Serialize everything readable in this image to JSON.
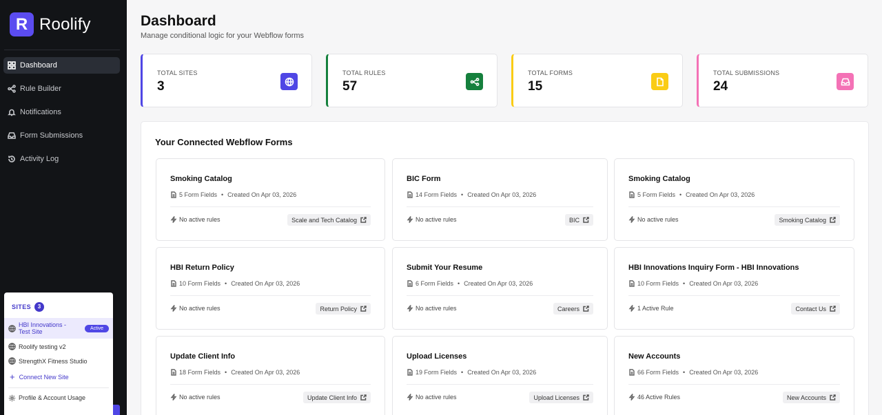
{
  "brand": {
    "logo_letter": "R",
    "name": "Roolify"
  },
  "nav": [
    {
      "label": "Dashboard",
      "icon": "grid-icon",
      "active": true
    },
    {
      "label": "Rule Builder",
      "icon": "share-icon",
      "active": false
    },
    {
      "label": "Notifications",
      "icon": "bell-icon",
      "active": false
    },
    {
      "label": "Form Submissions",
      "icon": "inbox-icon",
      "active": false
    },
    {
      "label": "Activity Log",
      "icon": "history-icon",
      "active": false
    }
  ],
  "sites_popover": {
    "label": "SITES",
    "count": "3",
    "sites": [
      {
        "name": "HBI Innovations - Test Site",
        "badge": "Active"
      },
      {
        "name": "Roolify testing v2"
      },
      {
        "name": "StrengthX Fitness Studio"
      }
    ],
    "connect_label": "Connect New Site",
    "profile_label": "Profile & Account Usage"
  },
  "header": {
    "title": "Dashboard",
    "subtitle": "Manage conditional logic for your Webflow forms"
  },
  "stats": [
    {
      "label": "TOTAL SITES",
      "value": "3",
      "color": "#4f46e5",
      "icon": "globe-icon"
    },
    {
      "label": "TOTAL RULES",
      "value": "57",
      "color": "#15803d",
      "icon": "share-icon"
    },
    {
      "label": "TOTAL FORMS",
      "value": "15",
      "color": "#facc15",
      "icon": "file-icon"
    },
    {
      "label": "TOTAL SUBMISSIONS",
      "value": "24",
      "color": "#f472b6",
      "icon": "inbox-icon"
    }
  ],
  "forms_panel": {
    "title": "Your Connected Webflow Forms",
    "forms": [
      {
        "title": "Smoking Catalog",
        "fields": "5 Form Fields",
        "created": "Created On Apr 03, 2026",
        "rules": "No active rules",
        "tag": "Scale and Tech Catalog"
      },
      {
        "title": "BIC Form",
        "fields": "14 Form Fields",
        "created": "Created On Apr 03, 2026",
        "rules": "No active rules",
        "tag": "BIC"
      },
      {
        "title": "Smoking Catalog",
        "fields": "5 Form Fields",
        "created": "Created On Apr 03, 2026",
        "rules": "No active rules",
        "tag": "Smoking Catalog"
      },
      {
        "title": "HBI Return Policy",
        "fields": "10 Form Fields",
        "created": "Created On Apr 03, 2026",
        "rules": "No active rules",
        "tag": "Return Policy"
      },
      {
        "title": "Submit Your Resume",
        "fields": "6 Form Fields",
        "created": "Created On Apr 03, 2026",
        "rules": "No active rules",
        "tag": "Careers"
      },
      {
        "title": "HBI Innovations Inquiry Form - HBI Innovations",
        "fields": "10 Form Fields",
        "created": "Created On Apr 03, 2026",
        "rules": "1 Active Rule",
        "tag": "Contact Us"
      },
      {
        "title": "Update Client Info",
        "fields": "18 Form Fields",
        "created": "Created On Apr 03, 2026",
        "rules": "No active rules",
        "tag": "Update Client Info"
      },
      {
        "title": "Upload Licenses",
        "fields": "19 Form Fields",
        "created": "Created On Apr 03, 2026",
        "rules": "No active rules",
        "tag": "Upload Licenses"
      },
      {
        "title": "New Accounts",
        "fields": "66 Form Fields",
        "created": "Created On Apr 03, 2026",
        "rules": "46 Active Rules",
        "tag": "New Accounts"
      }
    ]
  }
}
